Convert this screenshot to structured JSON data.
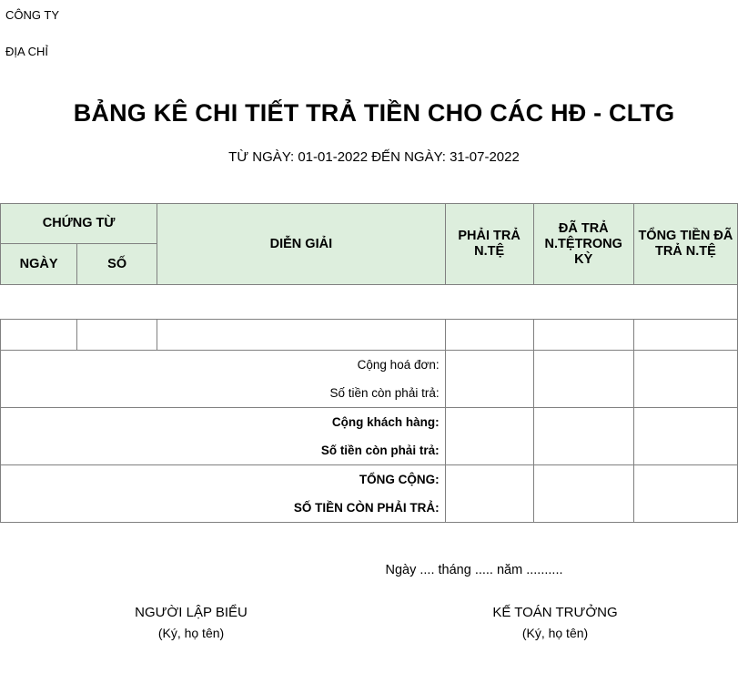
{
  "header": {
    "company_label": "CÔNG TY",
    "address_label": "ĐỊA CHỈ"
  },
  "title": {
    "main": "BẢNG KÊ CHI TIẾT TRẢ TIỀN CHO CÁC HĐ - CLTG",
    "subtitle": "TỪ NGÀY: 01-01-2022 ĐẾN NGÀY: 31-07-2022"
  },
  "table": {
    "group_header": "CHỨNG TỪ",
    "columns": [
      {
        "key": "ngay",
        "label": "NGÀY"
      },
      {
        "key": "so",
        "label": "SỐ"
      },
      {
        "key": "dien_giai",
        "label": "DIỄN GIẢI"
      },
      {
        "key": "phai_tra",
        "label": "PHẢI TRẢ N.TỆ"
      },
      {
        "key": "da_tra",
        "label": "ĐÃ TRẢ N.TỆTRONG KỲ"
      },
      {
        "key": "tong_tien",
        "label": "TỔNG TIỀN ĐÃ TRẢ N.TỆ"
      }
    ],
    "rows": [
      {
        "ngay": "",
        "so": "",
        "dien_giai": "",
        "phai_tra": "",
        "da_tra": "",
        "tong_tien": ""
      }
    ],
    "summaries": [
      {
        "lines": [
          {
            "label": "Cộng hoá đơn:",
            "bold": false
          },
          {
            "label": "Số tiền còn phải trả:",
            "bold": false
          }
        ],
        "phai_tra": "",
        "da_tra": "",
        "tong_tien": ""
      },
      {
        "lines": [
          {
            "label": "Cộng khách hàng:",
            "bold": true
          },
          {
            "label": "Số tiền còn phải trả:",
            "bold": true
          }
        ],
        "phai_tra": "",
        "da_tra": "",
        "tong_tien": ""
      },
      {
        "lines": [
          {
            "label": "TỔNG CỘNG:",
            "bold": true
          },
          {
            "label": "SỐ TIỀN CÒN PHẢI TRẢ:",
            "bold": true
          }
        ],
        "phai_tra": "",
        "da_tra": "",
        "tong_tien": ""
      }
    ]
  },
  "footer": {
    "date_line": "Ngày .... tháng ..... năm ..........",
    "signatures": [
      {
        "title": "NGƯỜI LẬP BIỂU",
        "sub": "(Ký, họ tên)"
      },
      {
        "title": "KẾ TOÁN TRƯỞNG",
        "sub": "(Ký, họ tên)"
      }
    ]
  },
  "colors": {
    "header_bg": "#ddeedd",
    "border": "#808080",
    "text": "#000000"
  }
}
